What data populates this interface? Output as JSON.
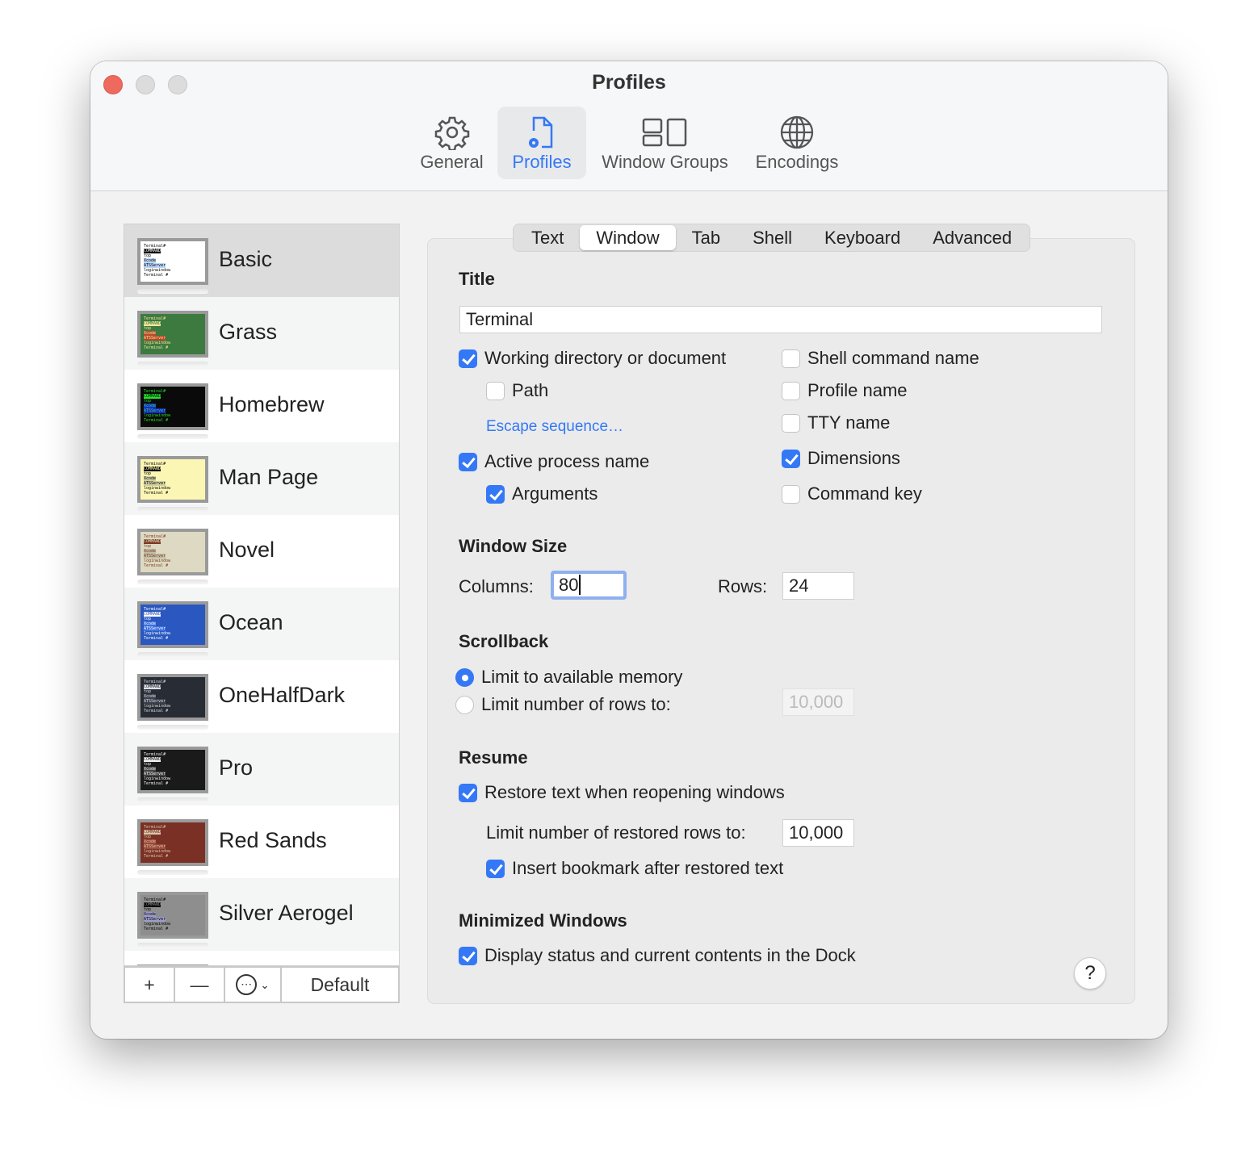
{
  "window": {
    "title": "Profiles"
  },
  "toolbar": [
    {
      "label": "General",
      "icon": "gear-icon"
    },
    {
      "label": "Profiles",
      "icon": "profile-doc-icon",
      "selected": true
    },
    {
      "label": "Window Groups",
      "icon": "window-groups-icon"
    },
    {
      "label": "Encodings",
      "icon": "globe-icon"
    }
  ],
  "profiles": [
    {
      "name": "Basic",
      "bg": "#ffffff",
      "fg": "#000000",
      "hl": "#b9d6f6",
      "selected": true
    },
    {
      "name": "Grass",
      "bg": "#3d7a40",
      "fg": "#f2e59a",
      "hl": "#b64b2a"
    },
    {
      "name": "Homebrew",
      "bg": "#0a0a0a",
      "fg": "#28e028",
      "hl": "#1a2ad6"
    },
    {
      "name": "Man Page",
      "bg": "#fcf6b4",
      "fg": "#000000",
      "hl": "#cfcfa0"
    },
    {
      "name": "Novel",
      "bg": "#ddd9c2",
      "fg": "#7a3a20",
      "hl": "#c0bca6"
    },
    {
      "name": "Ocean",
      "bg": "#2a58c0",
      "fg": "#ffffff",
      "hl": "#3c70e0"
    },
    {
      "name": "OneHalfDark",
      "bg": "#282c34",
      "fg": "#dcdfe4",
      "hl": "#3a3f4b"
    },
    {
      "name": "Pro",
      "bg": "#1a1a1a",
      "fg": "#f2f2f2",
      "hl": "#444444"
    },
    {
      "name": "Red Sands",
      "bg": "#7b3026",
      "fg": "#d8c8a8",
      "hl": "#9c4a3a"
    },
    {
      "name": "Silver Aerogel",
      "bg": "#8e8e8e",
      "fg": "#000000",
      "hl": "#9c9cc8"
    }
  ],
  "list_buttons": {
    "add": "+",
    "remove": "—",
    "more": "⋯",
    "default": "Default"
  },
  "tabs": [
    {
      "label": "Text"
    },
    {
      "label": "Window",
      "selected": true
    },
    {
      "label": "Tab"
    },
    {
      "label": "Shell"
    },
    {
      "label": "Keyboard"
    },
    {
      "label": "Advanced"
    }
  ],
  "title_section": {
    "heading": "Title",
    "value": "Terminal",
    "working_directory": {
      "label": "Working directory or document",
      "checked": true
    },
    "path": {
      "label": "Path",
      "checked": false
    },
    "escape_sequence": "Escape sequence…",
    "active_process": {
      "label": "Active process name",
      "checked": true
    },
    "arguments": {
      "label": "Arguments",
      "checked": true
    },
    "shell_command": {
      "label": "Shell command name",
      "checked": false
    },
    "profile_name": {
      "label": "Profile name",
      "checked": false
    },
    "tty_name": {
      "label": "TTY name",
      "checked": false
    },
    "dimensions": {
      "label": "Dimensions",
      "checked": true
    },
    "command_key": {
      "label": "Command key",
      "checked": false
    }
  },
  "window_size": {
    "heading": "Window Size",
    "columns_label": "Columns:",
    "columns": "80",
    "rows_label": "Rows:",
    "rows": "24"
  },
  "scrollback": {
    "heading": "Scrollback",
    "available_memory": "Limit to available memory",
    "limit_rows": "Limit number of rows to:",
    "limit_value": "10,000",
    "selected": "available_memory"
  },
  "resume": {
    "heading": "Resume",
    "restore_text": {
      "label": "Restore text when reopening windows",
      "checked": true
    },
    "restored_rows_label": "Limit number of restored rows to:",
    "restored_rows": "10,000",
    "bookmark": {
      "label": "Insert bookmark after restored text",
      "checked": true
    }
  },
  "minimized": {
    "heading": "Minimized Windows",
    "display_status": {
      "label": "Display status and current contents in the Dock",
      "checked": true
    }
  },
  "help": "?"
}
